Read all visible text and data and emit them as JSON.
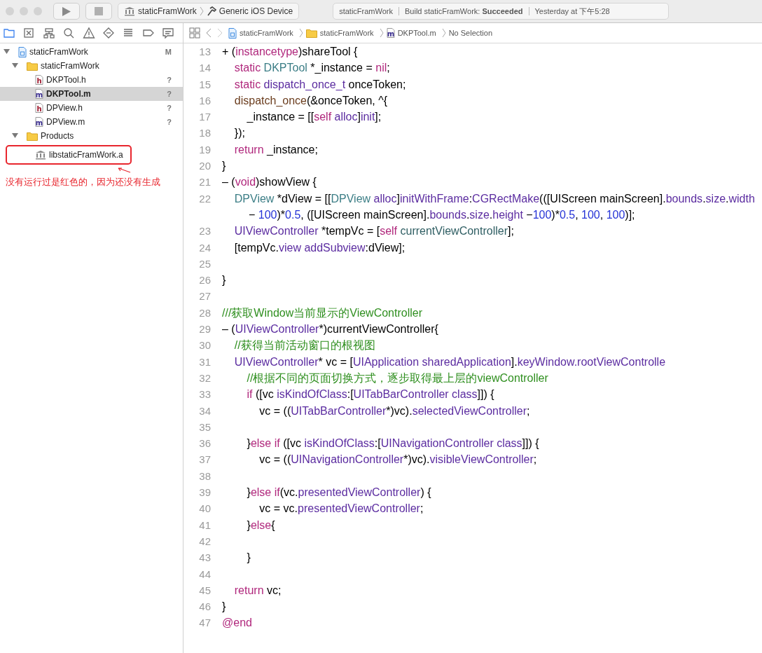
{
  "toolbar": {
    "scheme": "staticFramWork",
    "destination": "Generic iOS Device",
    "activity": {
      "project": "staticFramWork",
      "status": "Build staticFramWork: **Succeeded**",
      "time": "Yesterday at 下午5:28"
    }
  },
  "navigator": {
    "tabs": [
      {
        "kind": "folder",
        "selected": true
      },
      {
        "kind": "symbol",
        "selected": false
      },
      {
        "kind": "hierarchy",
        "selected": false
      },
      {
        "kind": "search",
        "selected": false
      },
      {
        "kind": "warning",
        "selected": false
      },
      {
        "kind": "test",
        "selected": false
      },
      {
        "kind": "debug",
        "selected": false
      },
      {
        "kind": "breakpoint",
        "selected": false
      },
      {
        "kind": "report",
        "selected": false
      }
    ],
    "tree": [
      {
        "kind": "project",
        "name": "staticFramWork",
        "badge": "M",
        "expanded": true,
        "selected": false,
        "children": [
          {
            "kind": "folder",
            "name": "staticFramWork",
            "expanded": true,
            "selected": false,
            "children": [
              {
                "kind": "h",
                "name": "DKPTool.h",
                "badge": "?",
                "selected": false
              },
              {
                "kind": "m",
                "name": "DKPTool.m",
                "badge": "?",
                "selected": true
              },
              {
                "kind": "h",
                "name": "DPView.h",
                "badge": "?",
                "selected": false
              },
              {
                "kind": "m",
                "name": "DPView.m",
                "badge": "?",
                "selected": false
              }
            ]
          },
          {
            "kind": "folder",
            "name": "Products",
            "expanded": true,
            "selected": false,
            "children": [
              {
                "kind": "lib",
                "name": "libstaticFramWork.a",
                "selected": false,
                "highlighted": true
              }
            ]
          }
        ]
      }
    ],
    "annotation": "没有运行过是红色的，因为还没有生成"
  },
  "jump_bar": [
    {
      "kind": "project",
      "text": "staticFramWork"
    },
    {
      "kind": "folder",
      "text": "staticFramWork"
    },
    {
      "kind": "m",
      "text": "DKPTool.m"
    },
    {
      "kind": "none",
      "text": "No Selection"
    }
  ],
  "code": [
    {
      "number": "13",
      "tokens": [
        {
          "kind": "p",
          "text": "+ ("
        },
        {
          "kind": "kw",
          "text": "instancetype"
        },
        {
          "kind": "p",
          "text": ")shareTool {"
        }
      ]
    },
    {
      "number": "14",
      "tokens": [
        {
          "kind": "kw",
          "text": "    static "
        },
        {
          "kind": "cls",
          "text": "DKPTool"
        },
        {
          "kind": "p",
          "text": " *_instance = "
        },
        {
          "kind": "kw",
          "text": "nil"
        },
        {
          "kind": "p",
          "text": ";"
        }
      ]
    },
    {
      "number": "15",
      "tokens": [
        {
          "kind": "kw",
          "text": "    static "
        },
        {
          "kind": "sys",
          "text": "dispatch_once_t"
        },
        {
          "kind": "p",
          "text": " onceToken;"
        }
      ]
    },
    {
      "number": "16",
      "tokens": [
        {
          "kind": "fn",
          "text": "    dispatch_once"
        },
        {
          "kind": "p",
          "text": "(&onceToken, ^{"
        }
      ]
    },
    {
      "number": "17",
      "tokens": [
        {
          "kind": "p",
          "text": "        _instance = [["
        },
        {
          "kind": "kw",
          "text": "self"
        },
        {
          "kind": "sys",
          "text": " alloc"
        },
        {
          "kind": "p",
          "text": "]"
        },
        {
          "kind": "sys",
          "text": "init"
        },
        {
          "kind": "p",
          "text": "];"
        }
      ]
    },
    {
      "number": "18",
      "tokens": [
        {
          "kind": "p",
          "text": "    });"
        }
      ]
    },
    {
      "number": "19",
      "tokens": [
        {
          "kind": "kw",
          "text": "    return"
        },
        {
          "kind": "p",
          "text": " _instance;"
        }
      ]
    },
    {
      "number": "20",
      "tokens": [
        {
          "kind": "p",
          "text": "}"
        }
      ]
    },
    {
      "number": "21",
      "tokens": [
        {
          "kind": "p",
          "text": "– ("
        },
        {
          "kind": "kw",
          "text": "void"
        },
        {
          "kind": "p",
          "text": ")showView {"
        }
      ]
    },
    {
      "number": "22",
      "tokens": [
        {
          "kind": "cls",
          "text": "    DPView"
        },
        {
          "kind": "p",
          "text": " *dView = [["
        },
        {
          "kind": "cls",
          "text": "DPView"
        },
        {
          "kind": "sys",
          "text": " alloc"
        },
        {
          "kind": "p",
          "text": "]"
        },
        {
          "kind": "sys",
          "text": "initWithFrame"
        },
        {
          "kind": "p",
          "text": ":"
        },
        {
          "kind": "sys",
          "text": "CGRectMake"
        },
        {
          "kind": "p",
          "text": "(([UIScreen mainScreen]."
        },
        {
          "kind": "sys",
          "text": "bounds"
        },
        {
          "kind": "p",
          "text": "."
        },
        {
          "kind": "sys",
          "text": "size"
        },
        {
          "kind": "p",
          "text": "."
        },
        {
          "kind": "sys",
          "text": "width"
        },
        {
          "kind": "p",
          "text": " − "
        },
        {
          "kind": "num",
          "text": "100"
        },
        {
          "kind": "p",
          "text": ")*"
        },
        {
          "kind": "num",
          "text": "0.5"
        },
        {
          "kind": "p",
          "text": ", ([UIScreen mainScreen]."
        },
        {
          "kind": "sys",
          "text": "bounds"
        },
        {
          "kind": "p",
          "text": "."
        },
        {
          "kind": "sys",
          "text": "size"
        },
        {
          "kind": "p",
          "text": "."
        },
        {
          "kind": "sys",
          "text": "height"
        },
        {
          "kind": "p",
          "text": " −"
        },
        {
          "kind": "num",
          "text": "100"
        },
        {
          "kind": "p",
          "text": ")*"
        },
        {
          "kind": "num",
          "text": "0.5"
        },
        {
          "kind": "p",
          "text": ", "
        },
        {
          "kind": "num",
          "text": "100"
        },
        {
          "kind": "p",
          "text": ", "
        },
        {
          "kind": "num",
          "text": "100"
        },
        {
          "kind": "p",
          "text": ")];"
        }
      ]
    },
    {
      "number": "23",
      "tokens": [
        {
          "kind": "sys",
          "text": "    UIViewController"
        },
        {
          "kind": "p",
          "text": " *tempVc = ["
        },
        {
          "kind": "kw",
          "text": "self"
        },
        {
          "kind": "meth",
          "text": " currentViewController"
        },
        {
          "kind": "p",
          "text": "];"
        }
      ]
    },
    {
      "number": "24",
      "tokens": [
        {
          "kind": "p",
          "text": "    [tempVc."
        },
        {
          "kind": "sys",
          "text": "view"
        },
        {
          "kind": "sys",
          "text": " addSubview"
        },
        {
          "kind": "p",
          "text": ":dView];"
        }
      ]
    },
    {
      "number": "25"
    },
    {
      "number": "26",
      "tokens": [
        {
          "kind": "p",
          "text": "}"
        }
      ]
    },
    {
      "number": "27"
    },
    {
      "number": "28",
      "tokens": [
        {
          "kind": "cm",
          "text": "///获取Window当前显示的ViewController"
        }
      ]
    },
    {
      "number": "29",
      "tokens": [
        {
          "kind": "p",
          "text": "– ("
        },
        {
          "kind": "sys",
          "text": "UIViewController"
        },
        {
          "kind": "p",
          "text": "*)currentViewController{"
        }
      ]
    },
    {
      "number": "30",
      "tokens": [
        {
          "kind": "cm",
          "text": "    //获得当前活动窗口的根视图"
        }
      ]
    },
    {
      "number": "31",
      "tokens": [
        {
          "kind": "sys",
          "text": "    UIViewController"
        },
        {
          "kind": "p",
          "text": "* vc = ["
        },
        {
          "kind": "sys",
          "text": "UIApplication sharedApplication"
        },
        {
          "kind": "p",
          "text": "]."
        },
        {
          "kind": "sys",
          "text": "keyWindow.rootViewControlle"
        }
      ]
    },
    {
      "number": "32",
      "tokens": [
        {
          "kind": "cm",
          "text": "        //根据不同的页面切换方式，逐步取得最上层的viewController"
        }
      ]
    },
    {
      "number": "33",
      "tokens": [
        {
          "kind": "kw",
          "text": "        if"
        },
        {
          "kind": "p",
          "text": " ([vc "
        },
        {
          "kind": "sys",
          "text": "isKindOfClass"
        },
        {
          "kind": "p",
          "text": ":["
        },
        {
          "kind": "sys",
          "text": "UITabBarController class"
        },
        {
          "kind": "p",
          "text": "]]) {"
        }
      ]
    },
    {
      "number": "34",
      "tokens": [
        {
          "kind": "p",
          "text": "            vc = (("
        },
        {
          "kind": "sys",
          "text": "UITabBarController"
        },
        {
          "kind": "p",
          "text": "*)vc)."
        },
        {
          "kind": "sys",
          "text": "selectedViewController"
        },
        {
          "kind": "p",
          "text": ";"
        }
      ]
    },
    {
      "number": "35"
    },
    {
      "number": "36",
      "tokens": [
        {
          "kind": "p",
          "text": "        }"
        },
        {
          "kind": "kw",
          "text": "else if"
        },
        {
          "kind": "p",
          "text": " ([vc "
        },
        {
          "kind": "sys",
          "text": "isKindOfClass"
        },
        {
          "kind": "p",
          "text": ":["
        },
        {
          "kind": "sys",
          "text": "UINavigationController class"
        },
        {
          "kind": "p",
          "text": "]]) {"
        }
      ]
    },
    {
      "number": "37",
      "tokens": [
        {
          "kind": "p",
          "text": "            vc = (("
        },
        {
          "kind": "sys",
          "text": "UINavigationController"
        },
        {
          "kind": "p",
          "text": "*)vc)."
        },
        {
          "kind": "sys",
          "text": "visibleViewController"
        },
        {
          "kind": "p",
          "text": ";"
        }
      ]
    },
    {
      "number": "38"
    },
    {
      "number": "39",
      "tokens": [
        {
          "kind": "p",
          "text": "        }"
        },
        {
          "kind": "kw",
          "text": "else if"
        },
        {
          "kind": "p",
          "text": "(vc."
        },
        {
          "kind": "sys",
          "text": "presentedViewController"
        },
        {
          "kind": "p",
          "text": ") {"
        }
      ]
    },
    {
      "number": "40",
      "tokens": [
        {
          "kind": "p",
          "text": "            vc = vc."
        },
        {
          "kind": "sys",
          "text": "presentedViewController"
        },
        {
          "kind": "p",
          "text": ";"
        }
      ]
    },
    {
      "number": "41",
      "tokens": [
        {
          "kind": "p",
          "text": "        }"
        },
        {
          "kind": "kw",
          "text": "else"
        },
        {
          "kind": "p",
          "text": "{"
        }
      ]
    },
    {
      "number": "42"
    },
    {
      "number": "43",
      "tokens": [
        {
          "kind": "p",
          "text": "        }"
        }
      ]
    },
    {
      "number": "44"
    },
    {
      "number": "45",
      "tokens": [
        {
          "kind": "kw",
          "text": "    return"
        },
        {
          "kind": "p",
          "text": " vc;"
        }
      ]
    },
    {
      "number": "46",
      "tokens": [
        {
          "kind": "p",
          "text": "}"
        }
      ]
    },
    {
      "number": "47",
      "tokens": [
        {
          "kind": "kw",
          "text": "@end"
        }
      ]
    }
  ]
}
